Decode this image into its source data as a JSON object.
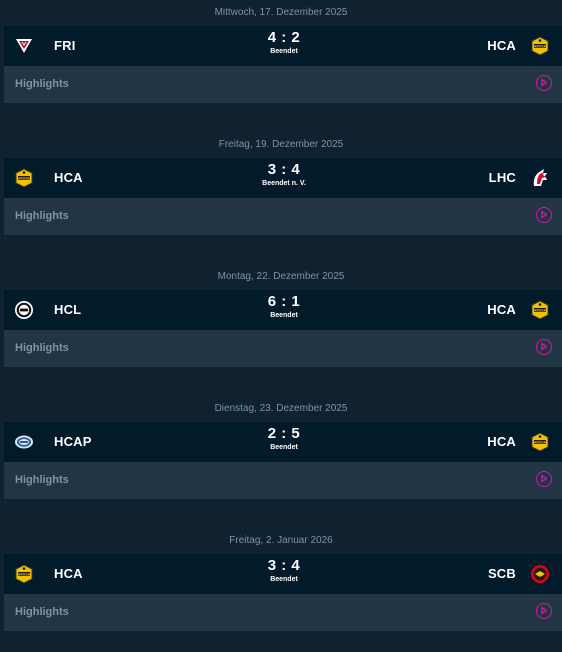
{
  "games": [
    {
      "date": "Mittwoch, 17. Dezember 2025",
      "home": {
        "abbr": "FRI",
        "logo": "fribourg-logo"
      },
      "away": {
        "abbr": "HCA",
        "logo": "hca-logo"
      },
      "score": "4 : 2",
      "status": "Beendet",
      "highlights": "Highlights"
    },
    {
      "date": "Freitag, 19. Dezember 2025",
      "home": {
        "abbr": "HCA",
        "logo": "hca-logo"
      },
      "away": {
        "abbr": "LHC",
        "logo": "lausanne-logo"
      },
      "score": "3 : 4",
      "status": "Beendet n. V.",
      "highlights": "Highlights"
    },
    {
      "date": "Montag, 22. Dezember 2025",
      "home": {
        "abbr": "HCL",
        "logo": "lugano-logo"
      },
      "away": {
        "abbr": "HCA",
        "logo": "hca-logo"
      },
      "score": "6 : 1",
      "status": "Beendet",
      "highlights": "Highlights"
    },
    {
      "date": "Dienstag, 23. Dezember 2025",
      "home": {
        "abbr": "HCAP",
        "logo": "ambri-logo"
      },
      "away": {
        "abbr": "HCA",
        "logo": "hca-logo"
      },
      "score": "2 : 5",
      "status": "Beendet",
      "highlights": "Highlights"
    },
    {
      "date": "Freitag, 2. Januar 2026",
      "home": {
        "abbr": "HCA",
        "logo": "hca-logo"
      },
      "away": {
        "abbr": "SCB",
        "logo": "bern-logo"
      },
      "score": "3 : 4",
      "status": "Beendet",
      "highlights": "Highlights"
    }
  ],
  "colors": {
    "background": "#10212f",
    "match_bar": "#021b2a",
    "highlights_bar": "#213545",
    "muted_text": "#7f93a4",
    "play_accent": "#d218a6"
  }
}
